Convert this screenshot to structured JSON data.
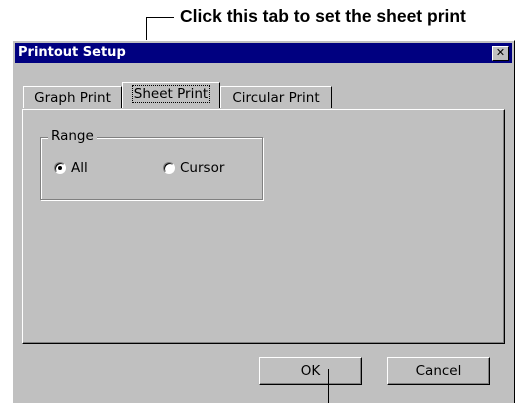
{
  "annotation": {
    "text": "Click this tab to set the sheet print"
  },
  "dialog": {
    "title": "Printout Setup",
    "close_glyph": "✕",
    "tabs": [
      {
        "label": "Graph Print",
        "active": false
      },
      {
        "label": "Sheet Print",
        "active": true
      },
      {
        "label": "Circular Print",
        "active": false
      }
    ],
    "range_group": {
      "label": "Range",
      "options": [
        {
          "label": "All",
          "selected": true
        },
        {
          "label": "Cursor",
          "selected": false
        }
      ]
    },
    "buttons": {
      "ok_label": "OK",
      "cancel_label": "Cancel"
    }
  },
  "colors": {
    "face": "#c0c0c0",
    "titlebar": "#000080"
  }
}
